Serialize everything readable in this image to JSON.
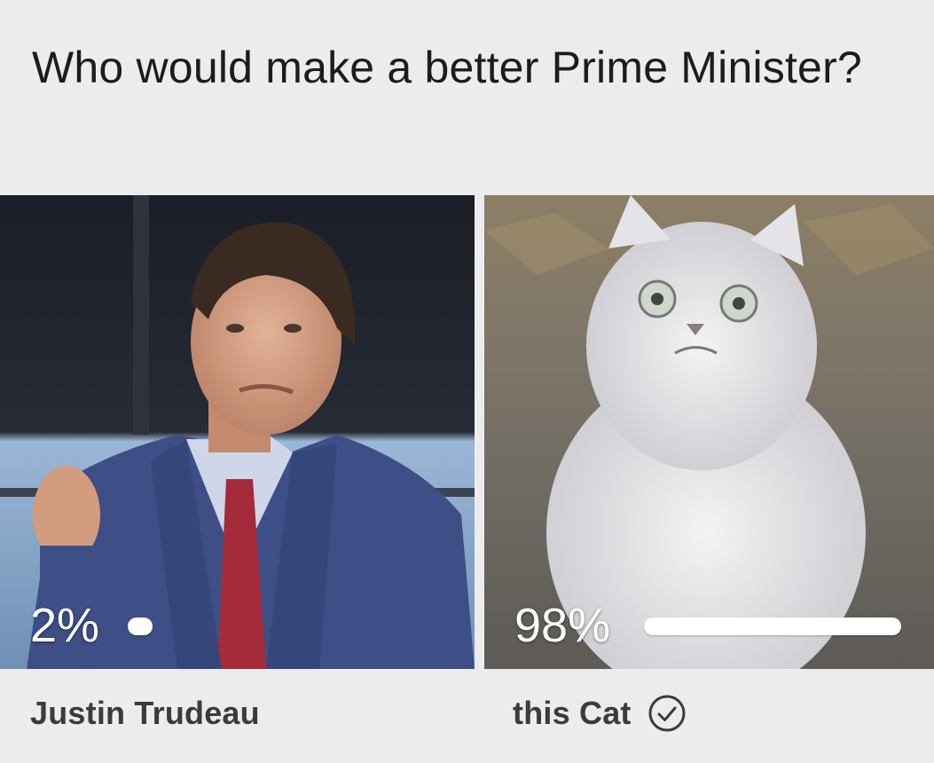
{
  "poll": {
    "question": "Who would make a better Prime Minister?",
    "options": [
      {
        "name": "Justin Trudeau",
        "percent_label": "2%",
        "percent": 2,
        "selected": false
      },
      {
        "name": "this Cat",
        "percent_label": "98%",
        "percent": 98,
        "selected": true
      }
    ]
  },
  "icons": {
    "selected": "check-circle-icon"
  },
  "colors": {
    "background": "#ececec",
    "bar": "#ffffff",
    "option_name": "#3b3b3b"
  }
}
